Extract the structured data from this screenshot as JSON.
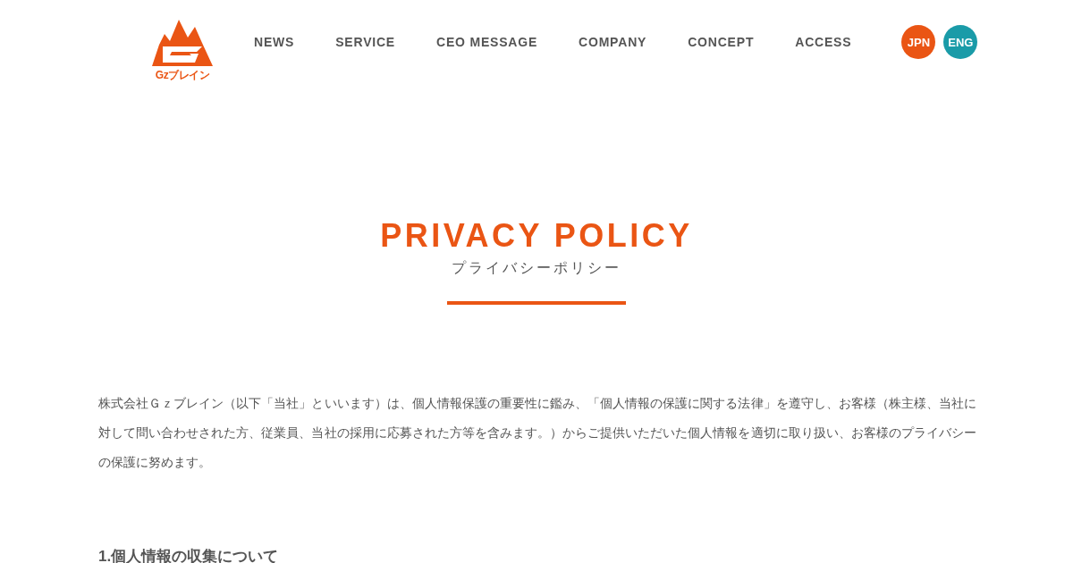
{
  "logo": {
    "text": "Gzブレイン"
  },
  "nav": [
    "NEWS",
    "SERVICE",
    "CEO MESSAGE",
    "COMPANY",
    "CONCEPT",
    "ACCESS"
  ],
  "languages": [
    {
      "label": "JPN",
      "color": "#ea5514"
    },
    {
      "label": "ENG",
      "color": "#1a9ba8"
    }
  ],
  "heading": {
    "title": "PRIVACY POLICY",
    "subtitle": "プライバシーポリシー"
  },
  "intro": "株式会社Ｇｚブレイン（以下「当社」といいます）は、個人情報保護の重要性に鑑み、「個人情報の保護に関する法律」を遵守し、お客様（株主様、当社に対して問い合わせされた方、従業員、当社の採用に応募された方等を含みます。）からご提供いただいた個人情報を適切に取り扱い、お客様のプライバシーの保護に努めます。",
  "section_title": "1.個人情報の収集について"
}
